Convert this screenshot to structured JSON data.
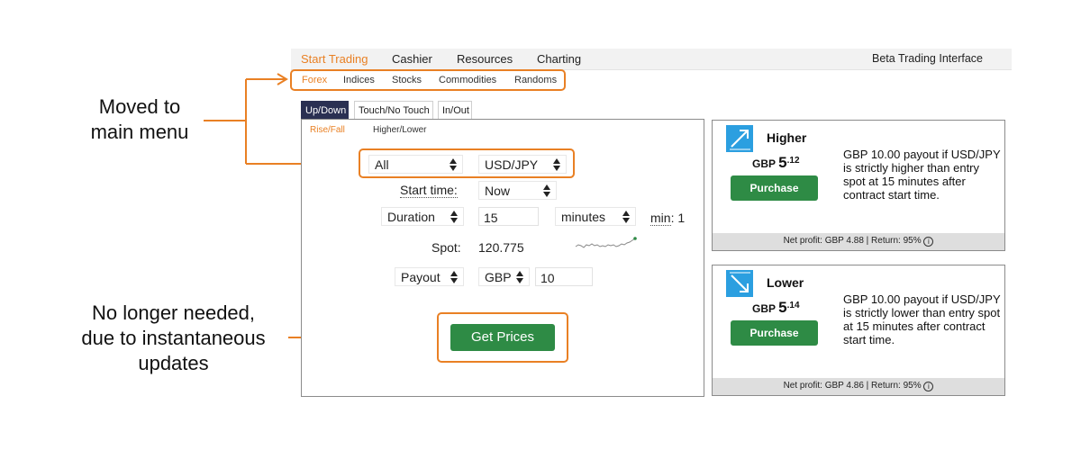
{
  "annotations": {
    "moved": {
      "line1": "Moved to",
      "line2": "main menu"
    },
    "no_longer": {
      "line1": "No longer needed,",
      "line2": "due to instantaneous",
      "line3": "updates"
    }
  },
  "top_menu": {
    "items": [
      "Start Trading",
      "Cashier",
      "Resources",
      "Charting"
    ],
    "active": "Start Trading",
    "right_label": "Beta Trading Interface"
  },
  "sub_menu": {
    "items": [
      "Forex",
      "Indices",
      "Stocks",
      "Commodities",
      "Randoms"
    ],
    "active": "Forex"
  },
  "contract_tabs": {
    "items": [
      "Up/Down",
      "Touch/No Touch",
      "In/Out"
    ],
    "active": "Up/Down"
  },
  "sub_tabs": {
    "items": [
      "Rise/Fall",
      "Higher/Lower"
    ],
    "active": "Rise/Fall"
  },
  "form": {
    "market_select": "All",
    "underlying_select": "USD/JPY",
    "start_time_label": "Start time:",
    "start_time_value": "Now",
    "duration_type": "Duration",
    "duration_value": "15",
    "duration_unit": "minutes",
    "min_label": "min",
    "min_value": ": 1",
    "spot_label": "Spot:",
    "spot_value": "120.775",
    "payout_select": "Payout",
    "currency_select": "GBP",
    "amount_value": "10",
    "get_prices_label": "Get Prices"
  },
  "cards": [
    {
      "title": "Higher",
      "icon": "arrow-up-right-icon",
      "currency": "GBP",
      "price_major": "5",
      "price_minor": ".12",
      "purchase_label": "Purchase",
      "description": "GBP 10.00 payout if USD/JPY is strictly higher than entry spot at 15 minutes after contract start time.",
      "footer": "Net profit: GBP 4.88 | Return: 95%"
    },
    {
      "title": "Lower",
      "icon": "arrow-down-right-icon",
      "currency": "GBP",
      "price_major": "5",
      "price_minor": ".14",
      "purchase_label": "Purchase",
      "description": "GBP 10.00 payout if USD/JPY is strictly lower than entry spot at 15 minutes after contract start time.",
      "footer": "Net profit: GBP 4.86 | Return: 95%"
    }
  ],
  "info_glyph": "i",
  "colors": {
    "accent_orange": "#e98024",
    "button_green": "#2e8b45",
    "tab_active_navy": "#2a3052",
    "icon_blue": "#2b9fe0",
    "footer_gray": "#dedede"
  }
}
